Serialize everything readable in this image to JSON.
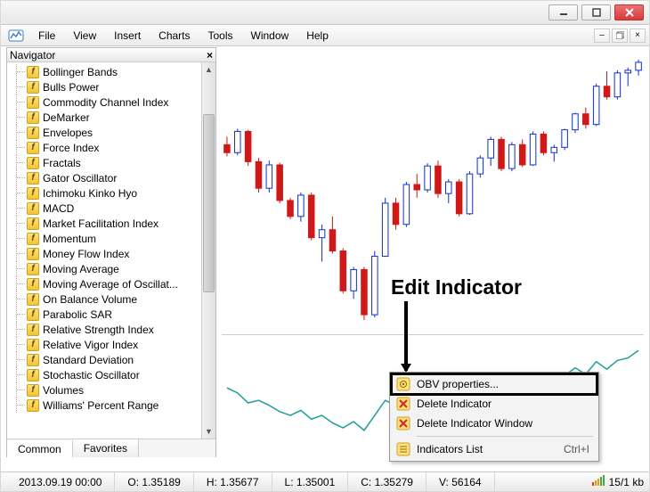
{
  "menu": {
    "items": [
      "File",
      "View",
      "Insert",
      "Charts",
      "Tools",
      "Window",
      "Help"
    ]
  },
  "navigator": {
    "title": "Navigator",
    "tabs": [
      "Common",
      "Favorites"
    ],
    "active_tab": 0,
    "items": [
      "Bollinger Bands",
      "Bulls Power",
      "Commodity Channel Index",
      "DeMarker",
      "Envelopes",
      "Force Index",
      "Fractals",
      "Gator Oscillator",
      "Ichimoku Kinko Hyo",
      "MACD",
      "Market Facilitation Index",
      "Momentum",
      "Money Flow Index",
      "Moving Average",
      "Moving Average of Oscillat...",
      "On Balance Volume",
      "Parabolic SAR",
      "Relative Strength Index",
      "Relative Vigor Index",
      "Standard Deviation",
      "Stochastic Oscillator",
      "Volumes",
      "Williams' Percent Range"
    ]
  },
  "annotation": {
    "label": "Edit Indicator"
  },
  "context_menu": {
    "items": [
      {
        "label": "OBV properties...",
        "icon": "gear"
      },
      {
        "label": "Delete Indicator",
        "icon": "delx"
      },
      {
        "label": "Delete Indicator Window",
        "icon": "delx"
      }
    ],
    "sep": true,
    "list": {
      "label": "Indicators List",
      "icon": "list",
      "shortcut": "Ctrl+I"
    }
  },
  "status": {
    "datetime": "2013.09.19 00:00",
    "o": "O: 1.35189",
    "h": "H: 1.35677",
    "l": "L: 1.35001",
    "c": "C: 1.35279",
    "v": "V: 56164",
    "net": "15/1 kb"
  },
  "chart_data": {
    "type": "candlestick",
    "title": "",
    "x": [
      1,
      2,
      3,
      4,
      5,
      6,
      7,
      8,
      9,
      10,
      11,
      12,
      13,
      14,
      15,
      16,
      17,
      18,
      19,
      20,
      21,
      22,
      23,
      24,
      25,
      26,
      27,
      28,
      29,
      30,
      31,
      32,
      33,
      34,
      35,
      36,
      37,
      38,
      39,
      40
    ],
    "ohlc": [
      [
        1.353,
        1.3545,
        1.3508,
        1.3515
      ],
      [
        1.3515,
        1.356,
        1.351,
        1.3555
      ],
      [
        1.3555,
        1.3558,
        1.349,
        1.3498
      ],
      [
        1.3498,
        1.3505,
        1.344,
        1.3448
      ],
      [
        1.3448,
        1.35,
        1.344,
        1.3492
      ],
      [
        1.3492,
        1.3496,
        1.342,
        1.3425
      ],
      [
        1.3425,
        1.343,
        1.339,
        1.3395
      ],
      [
        1.3395,
        1.344,
        1.3385,
        1.3435
      ],
      [
        1.3435,
        1.344,
        1.335,
        1.3355
      ],
      [
        1.3355,
        1.338,
        1.331,
        1.337
      ],
      [
        1.337,
        1.3395,
        1.3325,
        1.333
      ],
      [
        1.333,
        1.3335,
        1.325,
        1.3255
      ],
      [
        1.3255,
        1.33,
        1.324,
        1.3295
      ],
      [
        1.3295,
        1.33,
        1.32,
        1.321
      ],
      [
        1.321,
        1.333,
        1.3205,
        1.332
      ],
      [
        1.332,
        1.343,
        1.332,
        1.342
      ],
      [
        1.342,
        1.343,
        1.337,
        1.338
      ],
      [
        1.338,
        1.346,
        1.3375,
        1.3455
      ],
      [
        1.3455,
        1.3475,
        1.343,
        1.3445
      ],
      [
        1.3445,
        1.3495,
        1.344,
        1.349
      ],
      [
        1.349,
        1.35,
        1.343,
        1.3438
      ],
      [
        1.3438,
        1.3465,
        1.342,
        1.346
      ],
      [
        1.346,
        1.3465,
        1.3395,
        1.34
      ],
      [
        1.34,
        1.348,
        1.3398,
        1.3475
      ],
      [
        1.3475,
        1.351,
        1.3468,
        1.3505
      ],
      [
        1.3505,
        1.3545,
        1.349,
        1.354
      ],
      [
        1.354,
        1.3545,
        1.348,
        1.3485
      ],
      [
        1.3485,
        1.3535,
        1.348,
        1.353
      ],
      [
        1.353,
        1.354,
        1.3488,
        1.3492
      ],
      [
        1.3492,
        1.3555,
        1.349,
        1.355
      ],
      [
        1.355,
        1.3555,
        1.351,
        1.3515
      ],
      [
        1.3515,
        1.353,
        1.3498,
        1.3525
      ],
      [
        1.3525,
        1.356,
        1.352,
        1.3558
      ],
      [
        1.3558,
        1.359,
        1.3552,
        1.3588
      ],
      [
        1.3588,
        1.36,
        1.356,
        1.3568
      ],
      [
        1.3568,
        1.3645,
        1.3565,
        1.364
      ],
      [
        1.364,
        1.3668,
        1.3615,
        1.362
      ],
      [
        1.362,
        1.367,
        1.3615,
        1.3665
      ],
      [
        1.3665,
        1.3675,
        1.364,
        1.367
      ],
      [
        1.367,
        1.369,
        1.366,
        1.3685
      ]
    ],
    "ylim": [
      1.318,
      1.371
    ],
    "indicator": {
      "name": "OBV",
      "type": "line",
      "values": [
        52,
        48,
        40,
        42,
        38,
        33,
        30,
        34,
        27,
        30,
        24,
        20,
        25,
        18,
        30,
        42,
        38,
        46,
        44,
        50,
        44,
        47,
        41,
        49,
        53,
        58,
        52,
        57,
        51,
        60,
        54,
        57,
        62,
        68,
        63,
        73,
        67,
        74,
        76,
        82
      ],
      "ylim": [
        15,
        90
      ],
      "color": "#1f9e98"
    }
  }
}
